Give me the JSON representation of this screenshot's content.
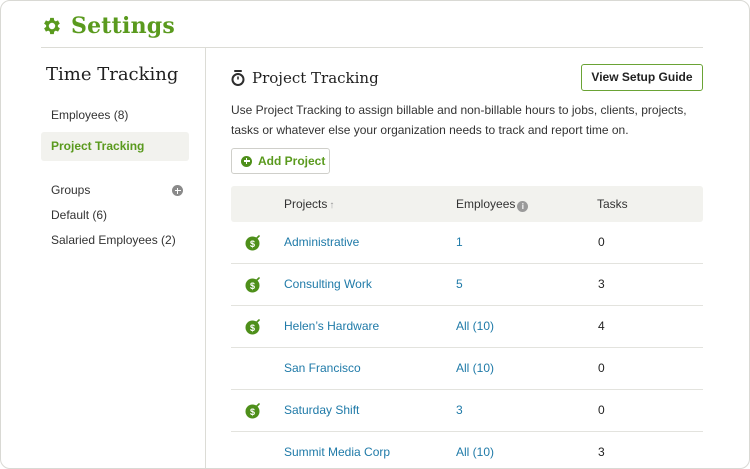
{
  "header": {
    "title": "Settings",
    "icon": "gear-icon",
    "brand_color": "#5a9a1e"
  },
  "sidebar": {
    "title": "Time Tracking",
    "items": [
      {
        "label": "Employees (8)",
        "active": false
      },
      {
        "label": "Project Tracking",
        "active": true
      }
    ],
    "groups": {
      "label": "Groups",
      "add_icon": "plus-circle-icon",
      "items": [
        {
          "label": "Default (6)"
        },
        {
          "label": "Salaried Employees (2)"
        }
      ]
    }
  },
  "main": {
    "icon": "stopwatch-icon",
    "title": "Project Tracking",
    "setup_guide_label": "View Setup Guide",
    "description": "Use Project Tracking to assign billable and non-billable hours to jobs, clients, projects, tasks or whatever else your organization needs to track and report time on.",
    "add_project_label": "Add Project",
    "table": {
      "columns": {
        "projects": "Projects",
        "projects_sort": "↑",
        "employees": "Employees",
        "employees_info": "i",
        "tasks": "Tasks"
      },
      "rows": [
        {
          "billable": true,
          "project": "Administrative",
          "employees": "1",
          "tasks": "0"
        },
        {
          "billable": true,
          "project": "Consulting Work",
          "employees": "5",
          "tasks": "3"
        },
        {
          "billable": true,
          "project": "Helen’s Hardware",
          "employees": "All (10)",
          "tasks": "4"
        },
        {
          "billable": false,
          "project": "San Francisco",
          "employees": "All (10)",
          "tasks": "0"
        },
        {
          "billable": true,
          "project": "Saturday Shift",
          "employees": "3",
          "tasks": "0"
        },
        {
          "billable": false,
          "project": "Summit Media Corp",
          "employees": "All (10)",
          "tasks": "3"
        }
      ]
    }
  }
}
